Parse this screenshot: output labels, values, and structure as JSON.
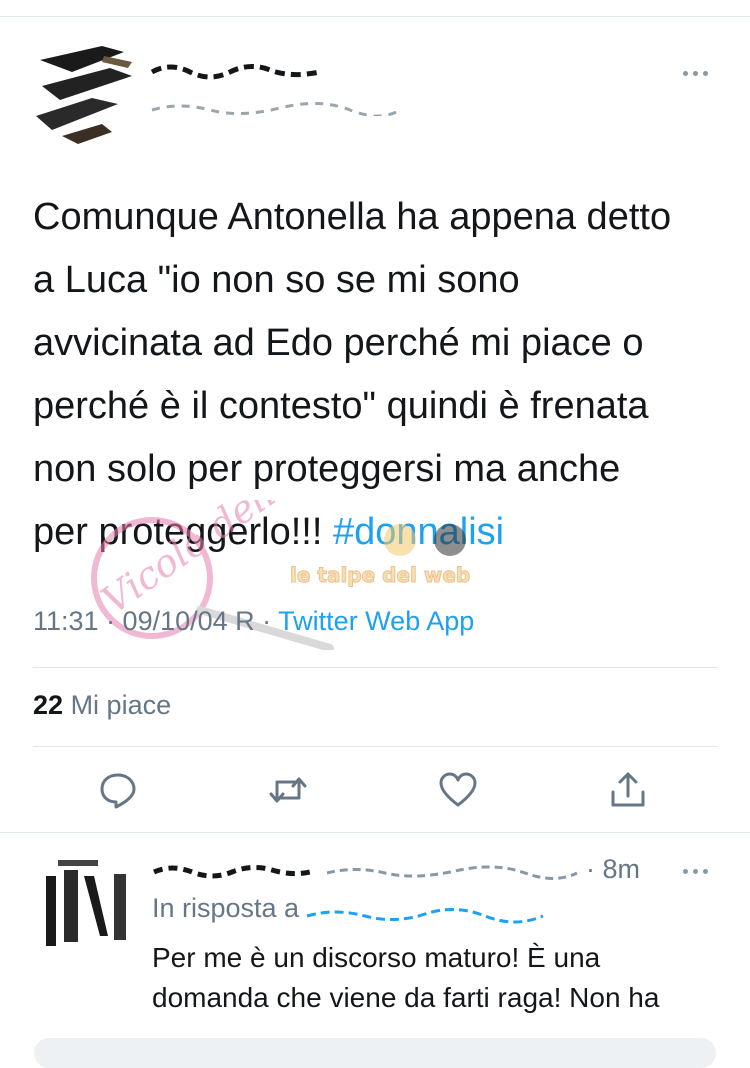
{
  "tweet": {
    "text_lines": [
      "Comunque Antonella ha appena detto",
      "a Luca \"io non so se mi sono",
      "avvicinata ad Edo perché mi piace o",
      "perché è il contesto\" quindi è frenata",
      "non solo per proteggersi ma anche",
      "per proteggerlo!!! "
    ],
    "hashtag": "#donnalisi",
    "time": "11:31 · 09/10/04 R",
    "separator": " · ",
    "source": "Twitter Web App",
    "likes_count": "22",
    "likes_label": "Mi piace",
    "actions": [
      "reply-icon",
      "retweet-icon",
      "like-icon",
      "share-icon"
    ]
  },
  "reply": {
    "time": "· 8m",
    "in_reply_prefix": "In risposta a",
    "text": "Per me è un discorso maturo! È una\ndomanda che viene da farti raga! Non ha"
  },
  "watermark": {
    "text_left": "Vicolo delle News",
    "text_right": "le talpe del web"
  },
  "colors": {
    "text": "#14171a",
    "secondary": "#657786",
    "link": "#1da1f2",
    "divider": "#e1e8ed"
  }
}
